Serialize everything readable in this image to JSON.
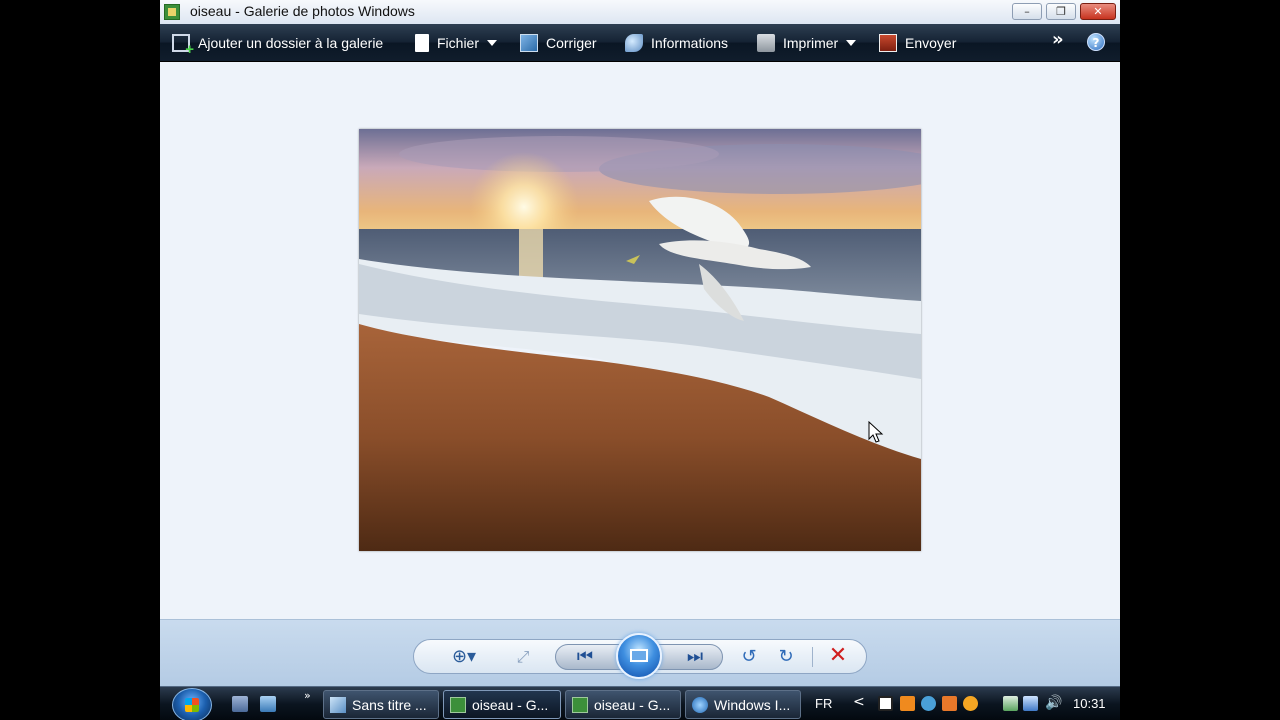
{
  "window": {
    "title": "oiseau - Galerie de photos Windows",
    "controls": {
      "minimize": "–",
      "maximize": "❐",
      "close": "✕"
    }
  },
  "toolbar": {
    "add_folder": "Ajouter un dossier à la galerie",
    "file": "Fichier",
    "fix": "Corriger",
    "info": "Informations",
    "print": "Imprimer",
    "send": "Envoyer",
    "more": "»",
    "help": "?"
  },
  "viewer": {
    "image_subject": "seagull flying over beach at sunset",
    "icons": {
      "zoom": "⊕▾",
      "fit": "⤢",
      "previous": "⏮",
      "next": "⏭",
      "rotate_left": "↺",
      "rotate_right": "↻",
      "delete": "✕"
    }
  },
  "taskbar": {
    "quick_more": "»",
    "tasks": [
      {
        "label": "Sans titre ..."
      },
      {
        "label": "oiseau - G..."
      },
      {
        "label": "oiseau - G..."
      },
      {
        "label": "Windows I..."
      }
    ],
    "language": "FR",
    "tray_expand": "<",
    "volume": "🔊",
    "clock": "10:31"
  },
  "colors": {
    "toolbar_bg": "#101d2c",
    "canvas_bg": "#eef3fa",
    "control_bar_bg": "#c9dbee",
    "delete_red": "#d01e1e"
  }
}
